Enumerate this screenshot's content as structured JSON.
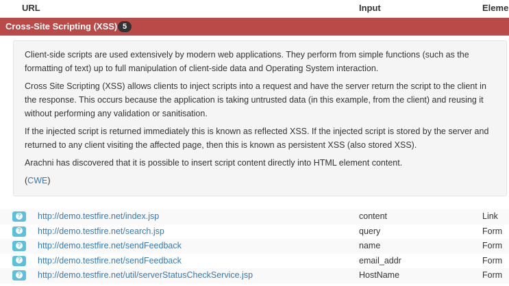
{
  "table": {
    "headers": {
      "url": "URL",
      "input": "Input",
      "element": "Eleme"
    }
  },
  "category": {
    "title": "Cross-Site Scripting (XSS)",
    "count": "5",
    "color": "#b94a48"
  },
  "description": {
    "p1": "Client-side scripts are used extensively by modern web applications. They perform from simple functions (such as the formatting of text) up to full manipulation of client-side data and Operating System interaction.",
    "p2": "Cross Site Scripting (XSS) allows clients to inject scripts into a request and have the server return the script to the client in the response. This occurs because the application is taking untrusted data (in this example, from the client) and reusing it without performing any validation or sanitisation.",
    "p3": "If the injected script is returned immediately this is known as reflected XSS. If the injected script is stored by the server and returned to any client visiting the affected page, then this is known as persistent XSS (also stored XSS).",
    "p4": "Arachni has discovered that it is possible to insert script content directly into HTML element content.",
    "cwe_open": "(",
    "cwe_link": "CWE",
    "cwe_close": ")"
  },
  "results": [
    {
      "icon": "question-icon",
      "url": "http://demo.testfire.net/index.jsp",
      "input": "content",
      "element": "Link"
    },
    {
      "icon": "question-icon",
      "url": "http://demo.testfire.net/search.jsp",
      "input": "query",
      "element": "Form"
    },
    {
      "icon": "question-icon",
      "url": "http://demo.testfire.net/sendFeedback",
      "input": "name",
      "element": "Form"
    },
    {
      "icon": "question-icon",
      "url": "http://demo.testfire.net/sendFeedback",
      "input": "email_addr",
      "element": "Form"
    },
    {
      "icon": "question-icon",
      "url": "http://demo.testfire.net/util/serverStatusCheckService.jsp",
      "input": "HostName",
      "element": "Form"
    }
  ]
}
